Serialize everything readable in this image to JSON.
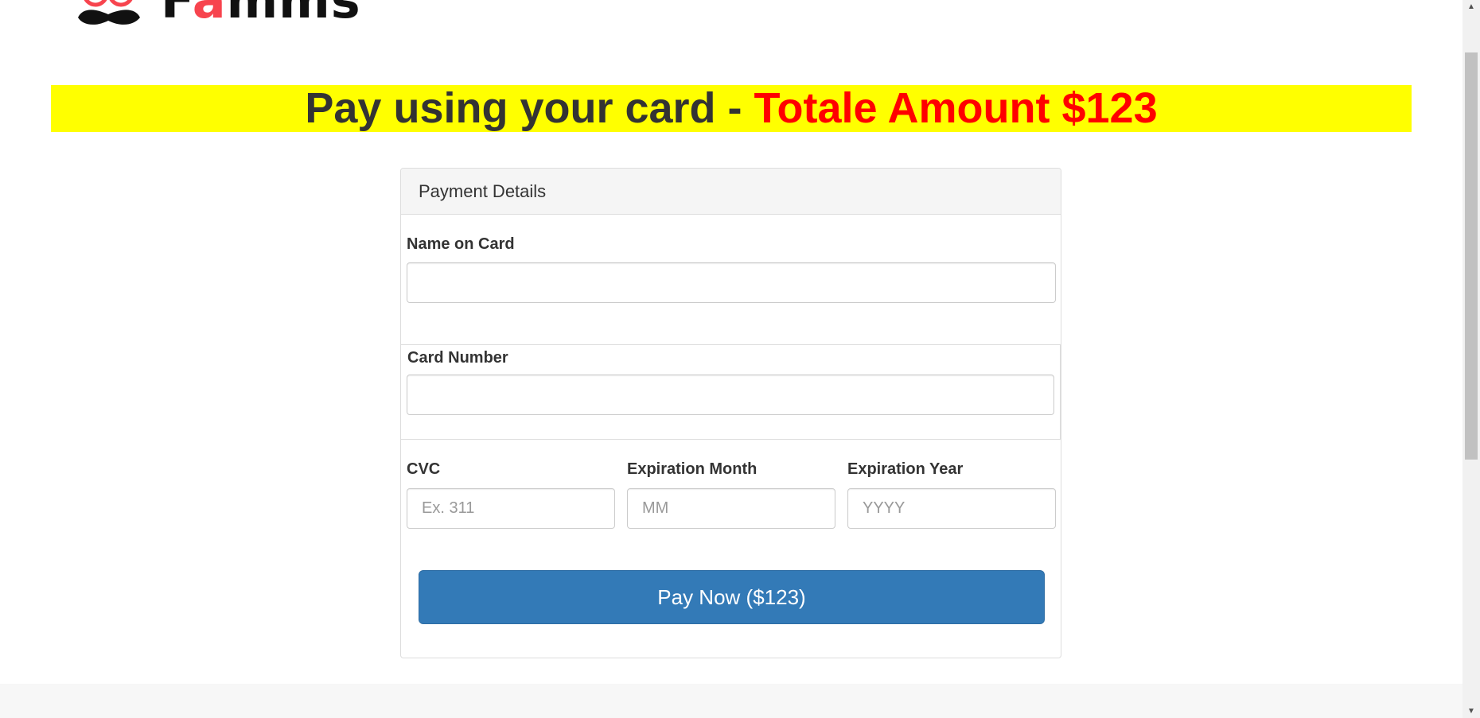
{
  "logo": {
    "text_before": "F",
    "text_accent": "a",
    "text_after": "mms",
    "icon": "mustache-glasses-icon"
  },
  "banner": {
    "prefix": "Pay using your card - ",
    "amount": "Totale Amount $123",
    "background": "#ffff00",
    "amount_color": "#ff0000"
  },
  "panel": {
    "heading": "Payment Details",
    "name_label": "Name on Card",
    "name_value": "",
    "card_label": "Card Number",
    "card_value": "",
    "cvc_label": "CVC",
    "cvc_placeholder": "Ex. 311",
    "month_label": "Expiration Month",
    "month_placeholder": "MM",
    "year_label": "Expiration Year",
    "year_placeholder": "YYYY",
    "pay_button": "Pay Now ($123)",
    "pay_button_color": "#337ab7"
  },
  "scrollbar": {
    "up_icon": "▲",
    "down_icon": "▼"
  }
}
